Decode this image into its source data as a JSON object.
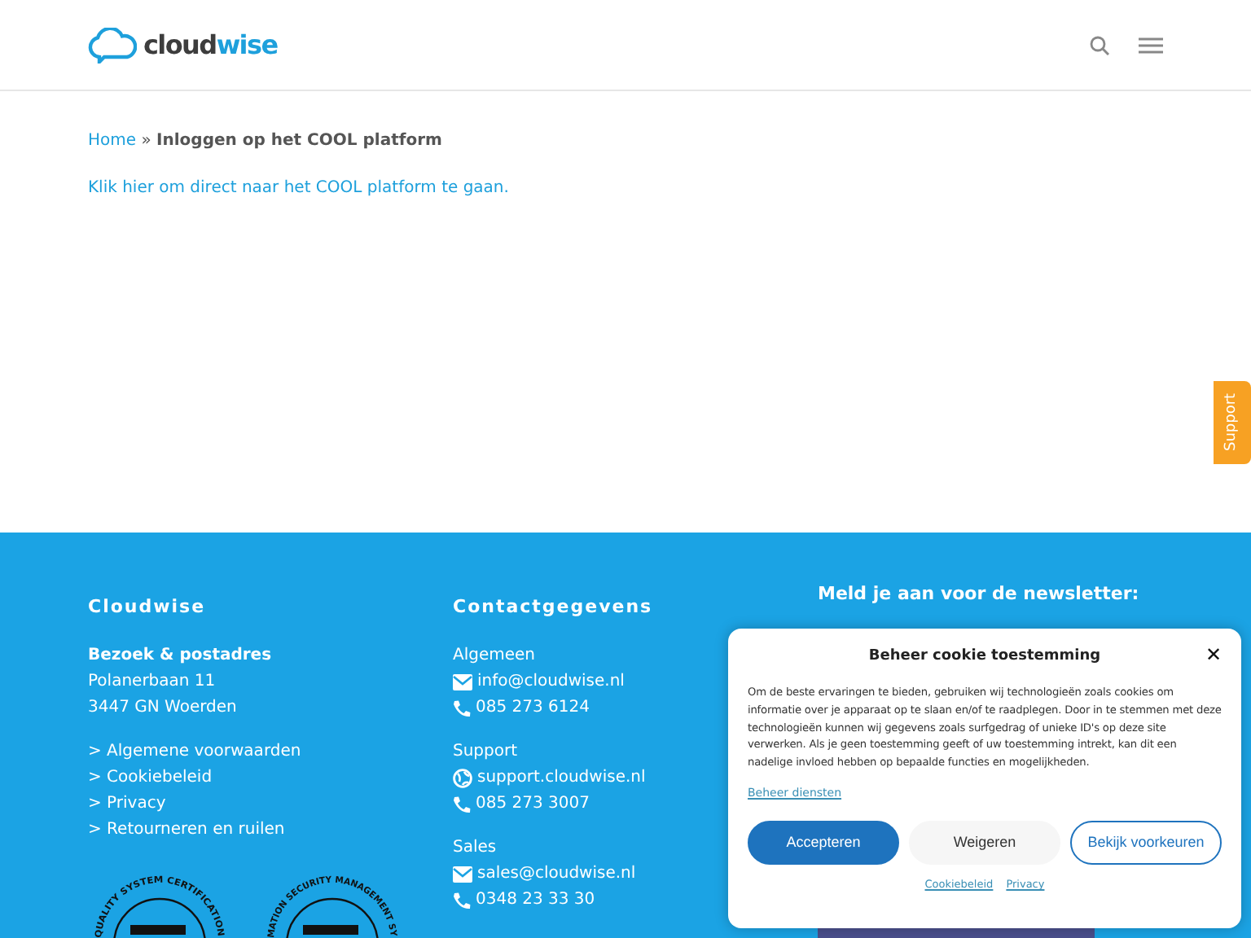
{
  "header": {
    "logo_text_dark": "cloud",
    "logo_text_accent": "wise"
  },
  "breadcrumb": {
    "home": "Home",
    "separator": "»",
    "current": "Inloggen op het COOL platform"
  },
  "content": {
    "link": "Klik hier om direct naar het COOL platform te gaan."
  },
  "support_tab": {
    "label": "Support"
  },
  "footer": {
    "columns": [
      {
        "title": "Cloudwise",
        "groups": [
          {
            "kind": "address",
            "heading": "Bezoek & postadres",
            "lines": [
              "Polanerbaan 11",
              "3447 GN  Woerden"
            ]
          },
          {
            "kind": "links",
            "items": [
              "> Algemene voorwaarden",
              "> Cookiebeleid",
              "> Privacy",
              "> Retourneren en ruilen"
            ]
          }
        ],
        "badges": [
          "QUALITY SYSTEM CERTIFICATION",
          "MATION SECURITY MANAGEMENT SY"
        ]
      },
      {
        "title": "Contactgegevens",
        "groups": [
          {
            "kind": "contact",
            "heading": "Algemeen",
            "entries": [
              {
                "kind": "mail",
                "text": "info@cloudwise.nl"
              },
              {
                "kind": "phone",
                "text": "085 273 6124"
              }
            ]
          },
          {
            "kind": "contact",
            "heading": "Support",
            "entries": [
              {
                "kind": "web",
                "text": "support.cloudwise.nl"
              },
              {
                "kind": "phone",
                "text": "085 273 3007"
              }
            ]
          },
          {
            "kind": "contact",
            "heading": "Sales",
            "entries": [
              {
                "kind": "mail",
                "text": "sales@cloudwise.nl"
              },
              {
                "kind": "phone",
                "text": "0348 23 33 30"
              }
            ]
          }
        ]
      },
      {
        "title": "Meld je aan voor de newsletter:"
      }
    ]
  },
  "cookie_dialog": {
    "title": "Beheer cookie toestemming",
    "close": "✕",
    "body": "Om de beste ervaringen te bieden, gebruiken wij technologieën zoals cookies om informatie over je apparaat op te slaan en/of te raadplegen. Door in te stemmen met deze technologieën kunnen wij gegevens zoals surfgedrag of unieke ID's op deze site verwerken. Als je geen toestemming geeft of uw toestemming intrekt, kan dit een nadelige invloed hebben op bepaalde functies en mogelijkheden.",
    "manage_link": "Beheer diensten",
    "buttons": [
      {
        "label": "Accepteren",
        "kind": "primary"
      },
      {
        "label": "Weigeren",
        "kind": "neutral"
      },
      {
        "label": "Bekijk voorkeuren",
        "kind": "outline"
      }
    ],
    "links": [
      "Cookiebeleid",
      "Privacy"
    ]
  }
}
